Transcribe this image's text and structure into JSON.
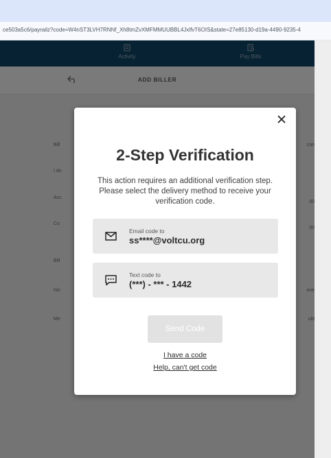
{
  "browser": {
    "url": "ce503a5c6/payrailz?code=W4nST3LVH7RNNf_Xh8tmZvXMFMMUUBBL4JxlfvT6OIS&state=27e85130-d19a-4490-9235-4"
  },
  "app_nav": {
    "tabs": [
      {
        "label": "Activity",
        "icon": "activity-icon"
      },
      {
        "label": "Pay Bills",
        "icon": "pay-bills-icon"
      }
    ]
  },
  "page": {
    "title": "ADD BILLER",
    "background_fields": {
      "left": [
        "Bill",
        "I do",
        "Acc",
        "Co",
        "Bill",
        "Nic",
        "Me"
      ],
      "right": [
        "con",
        "00",
        "00",
        "one",
        "uld"
      ]
    }
  },
  "modal": {
    "title": "2-Step Verification",
    "description": "This action requires an additional verification step. Please select the delivery method to receive your verification code.",
    "options": [
      {
        "label": "Email code to",
        "value": "ss****@voltcu.org",
        "icon": "envelope-icon"
      },
      {
        "label": "Text code to",
        "value": "(***) - *** - 1442",
        "icon": "message-icon"
      }
    ],
    "send_button": "Send Code",
    "have_code_link": "I have a code",
    "help_link": "Help, can't get code"
  },
  "colors": {
    "nav_bg": "#0f4466",
    "browser_top": "#dbe6fa",
    "option_bg": "#e8e8e8",
    "send_button_bg": "#e2e2e2"
  }
}
